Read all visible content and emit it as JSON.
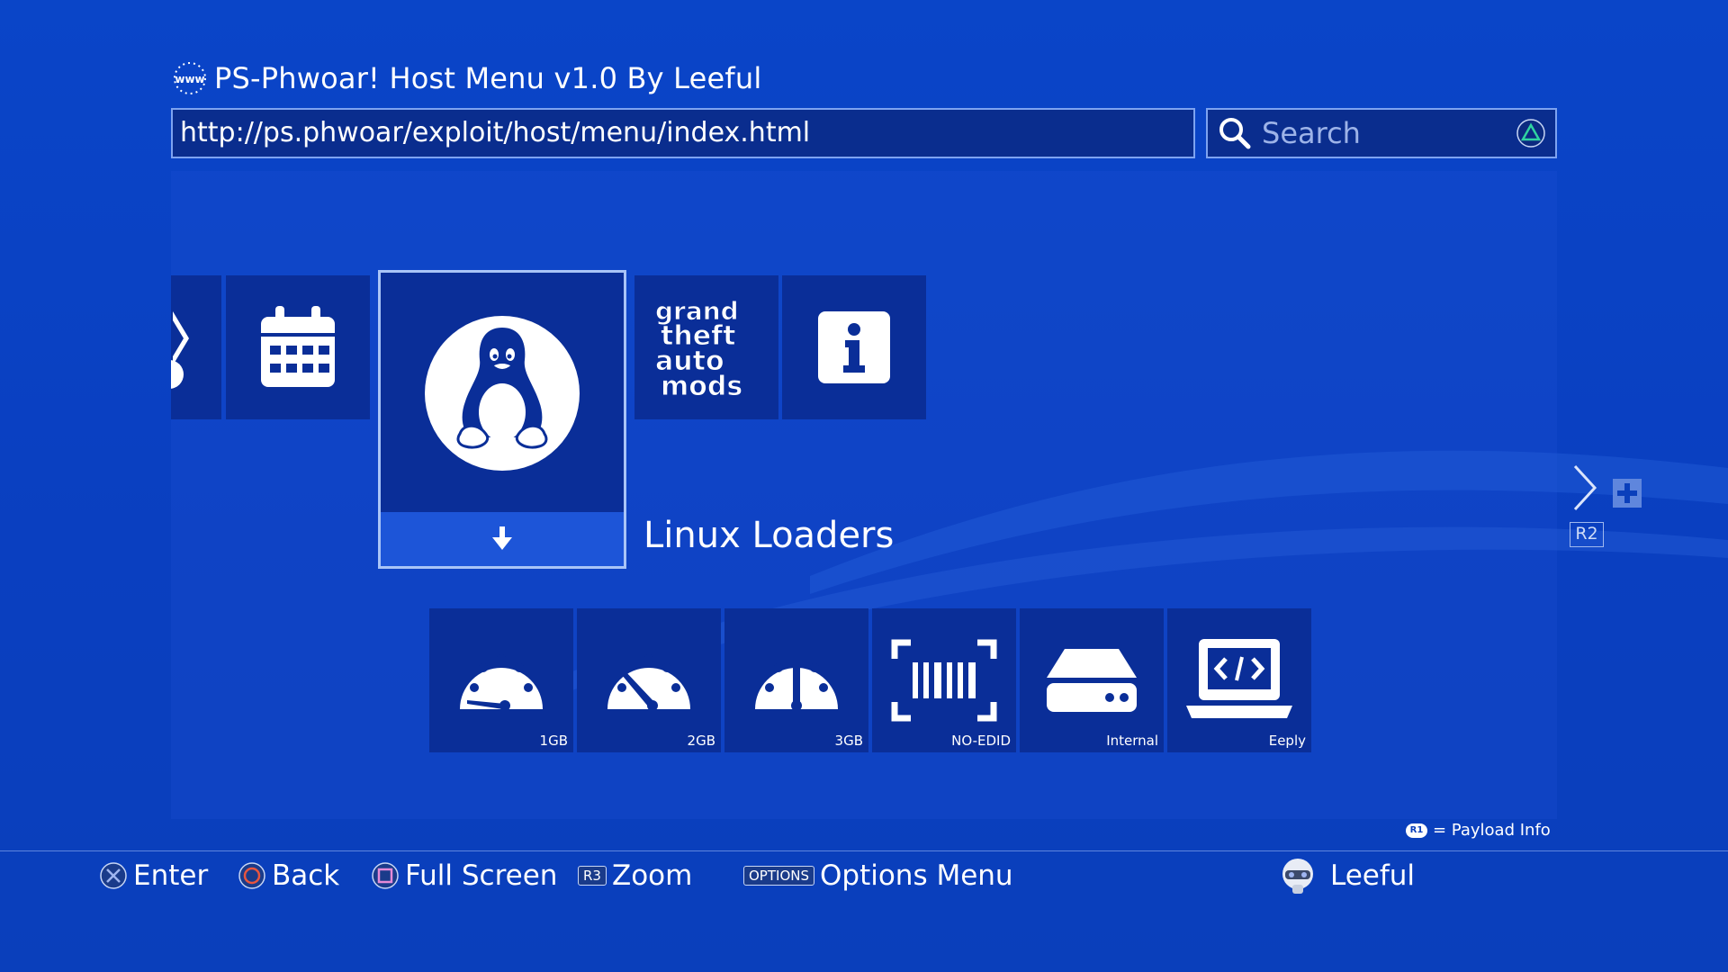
{
  "header": {
    "title": "PS-Phwoar! Host Menu v1.0 By Leeful",
    "www_icon_text": "www"
  },
  "url_bar": {
    "value": "http://ps.phwoar/exploit/host/menu/index.html"
  },
  "search": {
    "placeholder": "Search"
  },
  "top_row": [
    {
      "name": "partial-tile",
      "icon": "scissors-icon"
    },
    {
      "name": "calendar-tile",
      "icon": "calendar-icon"
    },
    {
      "name": "linux-tile",
      "icon": "tux-penguin-icon",
      "selected": true
    },
    {
      "name": "gta-mods-tile",
      "icon": "gta-logo-icon",
      "logo_text": "grand theft auto mods"
    },
    {
      "name": "info-tile",
      "icon": "info-icon"
    }
  ],
  "selected": {
    "label": "Linux Loaders"
  },
  "sub_items": [
    {
      "label": "1GB",
      "icon": "gauge-low-icon"
    },
    {
      "label": "2GB",
      "icon": "gauge-mid-icon"
    },
    {
      "label": "3GB",
      "icon": "gauge-high-icon"
    },
    {
      "label": "NO-EDID",
      "icon": "barcode-scan-icon"
    },
    {
      "label": "Internal",
      "icon": "hard-drive-icon"
    },
    {
      "label": "Eeply",
      "icon": "laptop-code-icon"
    }
  ],
  "side_nav": {
    "r2_label": "R2"
  },
  "payload_info": {
    "badge": "R1",
    "text": "= Payload Info"
  },
  "footer": {
    "enter": "Enter",
    "back": "Back",
    "full_screen": "Full Screen",
    "zoom_badge": "R3",
    "zoom": "Zoom",
    "options_badge": "OPTIONS",
    "options": "Options Menu",
    "user": "Leeful"
  },
  "colors": {
    "background": "#0a3fbb",
    "tile": "#0a2e98",
    "selected_bar": "#1d55d8",
    "triangle": "#2fd3a0",
    "circle": "#e8553e"
  }
}
